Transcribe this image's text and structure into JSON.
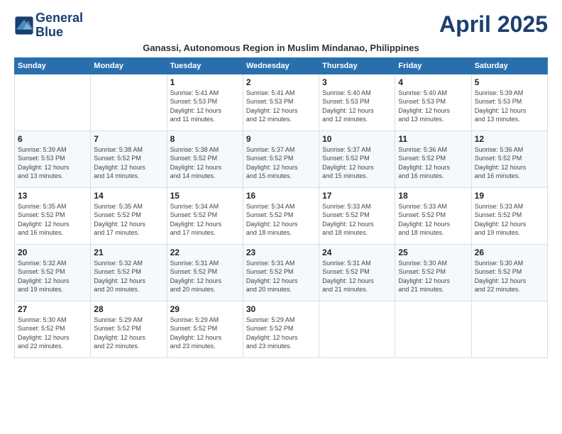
{
  "logo": {
    "line1": "General",
    "line2": "Blue"
  },
  "title": "April 2025",
  "subtitle": "Ganassi, Autonomous Region in Muslim Mindanao, Philippines",
  "days_of_week": [
    "Sunday",
    "Monday",
    "Tuesday",
    "Wednesday",
    "Thursday",
    "Friday",
    "Saturday"
  ],
  "weeks": [
    [
      {
        "day": "",
        "info": ""
      },
      {
        "day": "",
        "info": ""
      },
      {
        "day": "1",
        "info": "Sunrise: 5:41 AM\nSunset: 5:53 PM\nDaylight: 12 hours\nand 11 minutes."
      },
      {
        "day": "2",
        "info": "Sunrise: 5:41 AM\nSunset: 5:53 PM\nDaylight: 12 hours\nand 12 minutes."
      },
      {
        "day": "3",
        "info": "Sunrise: 5:40 AM\nSunset: 5:53 PM\nDaylight: 12 hours\nand 12 minutes."
      },
      {
        "day": "4",
        "info": "Sunrise: 5:40 AM\nSunset: 5:53 PM\nDaylight: 12 hours\nand 13 minutes."
      },
      {
        "day": "5",
        "info": "Sunrise: 5:39 AM\nSunset: 5:53 PM\nDaylight: 12 hours\nand 13 minutes."
      }
    ],
    [
      {
        "day": "6",
        "info": "Sunrise: 5:39 AM\nSunset: 5:53 PM\nDaylight: 12 hours\nand 13 minutes."
      },
      {
        "day": "7",
        "info": "Sunrise: 5:38 AM\nSunset: 5:52 PM\nDaylight: 12 hours\nand 14 minutes."
      },
      {
        "day": "8",
        "info": "Sunrise: 5:38 AM\nSunset: 5:52 PM\nDaylight: 12 hours\nand 14 minutes."
      },
      {
        "day": "9",
        "info": "Sunrise: 5:37 AM\nSunset: 5:52 PM\nDaylight: 12 hours\nand 15 minutes."
      },
      {
        "day": "10",
        "info": "Sunrise: 5:37 AM\nSunset: 5:52 PM\nDaylight: 12 hours\nand 15 minutes."
      },
      {
        "day": "11",
        "info": "Sunrise: 5:36 AM\nSunset: 5:52 PM\nDaylight: 12 hours\nand 16 minutes."
      },
      {
        "day": "12",
        "info": "Sunrise: 5:36 AM\nSunset: 5:52 PM\nDaylight: 12 hours\nand 16 minutes."
      }
    ],
    [
      {
        "day": "13",
        "info": "Sunrise: 5:35 AM\nSunset: 5:52 PM\nDaylight: 12 hours\nand 16 minutes."
      },
      {
        "day": "14",
        "info": "Sunrise: 5:35 AM\nSunset: 5:52 PM\nDaylight: 12 hours\nand 17 minutes."
      },
      {
        "day": "15",
        "info": "Sunrise: 5:34 AM\nSunset: 5:52 PM\nDaylight: 12 hours\nand 17 minutes."
      },
      {
        "day": "16",
        "info": "Sunrise: 5:34 AM\nSunset: 5:52 PM\nDaylight: 12 hours\nand 18 minutes."
      },
      {
        "day": "17",
        "info": "Sunrise: 5:33 AM\nSunset: 5:52 PM\nDaylight: 12 hours\nand 18 minutes."
      },
      {
        "day": "18",
        "info": "Sunrise: 5:33 AM\nSunset: 5:52 PM\nDaylight: 12 hours\nand 18 minutes."
      },
      {
        "day": "19",
        "info": "Sunrise: 5:33 AM\nSunset: 5:52 PM\nDaylight: 12 hours\nand 19 minutes."
      }
    ],
    [
      {
        "day": "20",
        "info": "Sunrise: 5:32 AM\nSunset: 5:52 PM\nDaylight: 12 hours\nand 19 minutes."
      },
      {
        "day": "21",
        "info": "Sunrise: 5:32 AM\nSunset: 5:52 PM\nDaylight: 12 hours\nand 20 minutes."
      },
      {
        "day": "22",
        "info": "Sunrise: 5:31 AM\nSunset: 5:52 PM\nDaylight: 12 hours\nand 20 minutes."
      },
      {
        "day": "23",
        "info": "Sunrise: 5:31 AM\nSunset: 5:52 PM\nDaylight: 12 hours\nand 20 minutes."
      },
      {
        "day": "24",
        "info": "Sunrise: 5:31 AM\nSunset: 5:52 PM\nDaylight: 12 hours\nand 21 minutes."
      },
      {
        "day": "25",
        "info": "Sunrise: 5:30 AM\nSunset: 5:52 PM\nDaylight: 12 hours\nand 21 minutes."
      },
      {
        "day": "26",
        "info": "Sunrise: 5:30 AM\nSunset: 5:52 PM\nDaylight: 12 hours\nand 22 minutes."
      }
    ],
    [
      {
        "day": "27",
        "info": "Sunrise: 5:30 AM\nSunset: 5:52 PM\nDaylight: 12 hours\nand 22 minutes."
      },
      {
        "day": "28",
        "info": "Sunrise: 5:29 AM\nSunset: 5:52 PM\nDaylight: 12 hours\nand 22 minutes."
      },
      {
        "day": "29",
        "info": "Sunrise: 5:29 AM\nSunset: 5:52 PM\nDaylight: 12 hours\nand 23 minutes."
      },
      {
        "day": "30",
        "info": "Sunrise: 5:29 AM\nSunset: 5:52 PM\nDaylight: 12 hours\nand 23 minutes."
      },
      {
        "day": "",
        "info": ""
      },
      {
        "day": "",
        "info": ""
      },
      {
        "day": "",
        "info": ""
      }
    ]
  ]
}
